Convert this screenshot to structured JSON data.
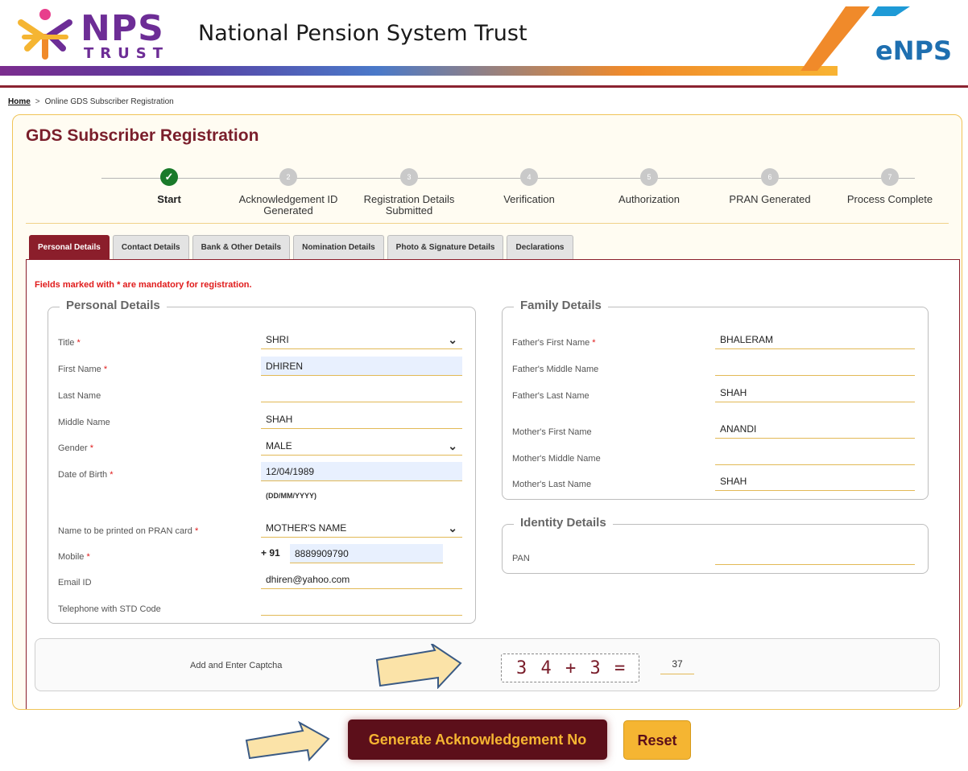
{
  "header": {
    "logo_main": "NPS",
    "logo_sub": "TRUST",
    "org_name": "National Pension System Trust",
    "enps_logo": "eNPS"
  },
  "breadcrumb": {
    "home": "Home",
    "separator": ">",
    "current": "Online GDS Subscriber Registration"
  },
  "page_title": "GDS Subscriber Registration",
  "steps": [
    {
      "num": "✓",
      "label": "Start",
      "done": true
    },
    {
      "num": "2",
      "label": "Acknowledgement ID Generated"
    },
    {
      "num": "3",
      "label": "Registration Details Submitted"
    },
    {
      "num": "4",
      "label": "Verification"
    },
    {
      "num": "5",
      "label": "Authorization"
    },
    {
      "num": "6",
      "label": "PRAN Generated"
    },
    {
      "num": "7",
      "label": "Process Complete"
    }
  ],
  "tabs": [
    "Personal Details",
    "Contact Details",
    "Bank & Other Details",
    "Nomination Details",
    "Photo & Signature Details",
    "Declarations"
  ],
  "mandatory_note": "Fields marked with * are mandatory for registration.",
  "personal": {
    "legend": "Personal Details",
    "title_label": "Title",
    "title_value": "SHRI",
    "first_name_label": "First Name",
    "first_name_value": "DHIREN",
    "last_name_label": "Last Name",
    "last_name_value": "",
    "middle_name_label": "Middle Name",
    "middle_name_value": "SHAH",
    "gender_label": "Gender",
    "gender_value": "MALE",
    "dob_label": "Date of Birth",
    "dob_value": "12/04/1989",
    "dob_hint": "(DD/MM/YYYY)",
    "pran_name_label": "Name to be printed on PRAN card",
    "pran_name_value": "MOTHER'S NAME",
    "mobile_label": "Mobile",
    "mobile_prefix": "+ 91",
    "mobile_value": "8889909790",
    "email_label": "Email ID",
    "email_value": "dhiren@yahoo.com",
    "telephone_label": "Telephone with STD Code",
    "telephone_value": "",
    "required_mark": "*"
  },
  "family": {
    "legend": "Family Details",
    "father_first_label": "Father's First Name",
    "father_first_value": "BHALERAM",
    "father_middle_label": "Father's Middle Name",
    "father_middle_value": "",
    "father_last_label": "Father's Last Name",
    "father_last_value": "SHAH",
    "mother_first_label": "Mother's First Name",
    "mother_first_value": "ANANDI",
    "mother_middle_label": "Mother's Middle Name",
    "mother_middle_value": "",
    "mother_last_label": "Mother's Last Name",
    "mother_last_value": "SHAH"
  },
  "identity": {
    "legend": "Identity Details",
    "pan_label": "PAN",
    "pan_value": ""
  },
  "captcha": {
    "label": "Add and Enter Captcha",
    "expression": "3 4 + 3 =",
    "answer": "37"
  },
  "buttons": {
    "generate": "Generate Acknowledgement No",
    "reset": "Reset"
  },
  "icons": {
    "dropdown": "chevron-down-icon",
    "check": "check-icon",
    "arrow": "arrow-right-icon"
  },
  "colors": {
    "brand_maroon": "#8b1e2b",
    "accent_gold": "#f5b532",
    "brand_purple": "#6d2d96",
    "required_red": "#e01b1b"
  }
}
